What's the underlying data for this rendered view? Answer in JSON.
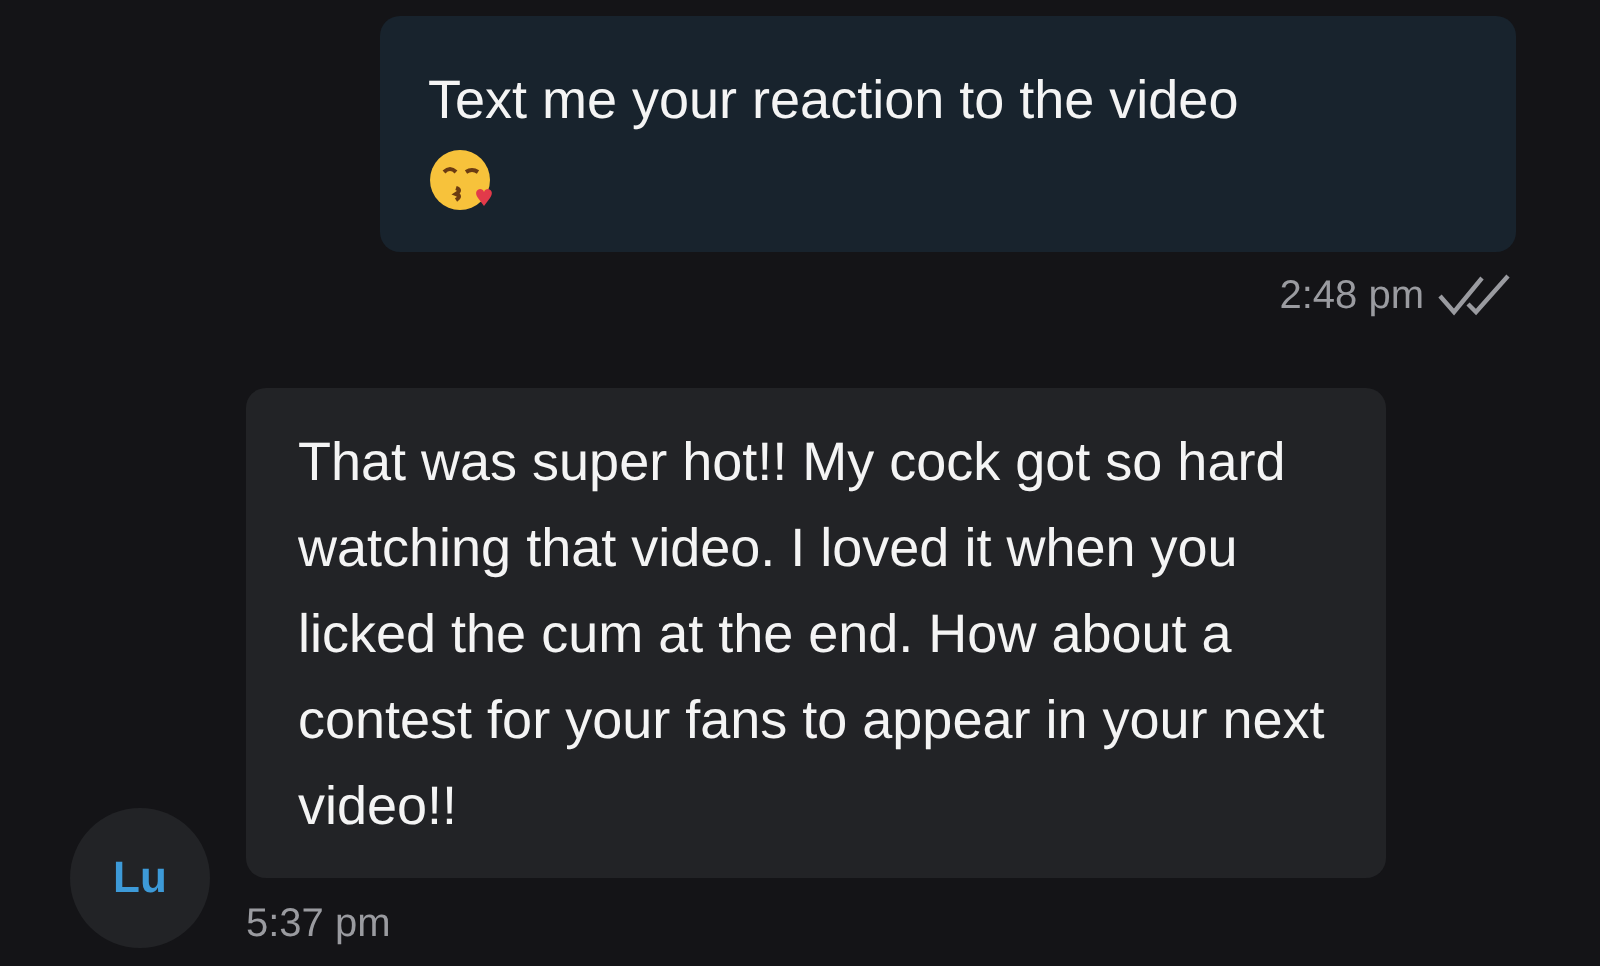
{
  "messages": [
    {
      "kind": "sent",
      "text": "Text me your reaction to the video",
      "time": "2:48 pm",
      "read": true
    },
    {
      "kind": "received",
      "avatar": "Lu",
      "text": "That was super hot!! My cock got so hard watching that video. I loved it when you licked the cum at the end. How about a contest for your fans to appear in your next video!!",
      "time": "5:37 pm"
    }
  ]
}
